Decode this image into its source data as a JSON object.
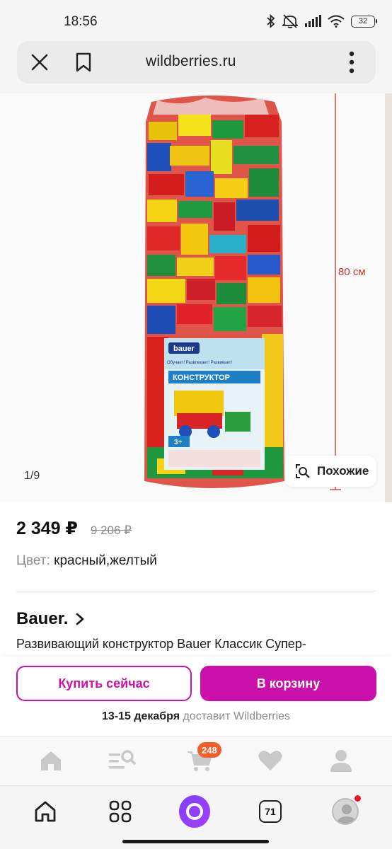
{
  "status_bar": {
    "time": "18:56",
    "battery": "32",
    "icons": [
      "bluetooth-icon",
      "mute-icon",
      "signal-icon",
      "wifi-icon",
      "battery-icon"
    ]
  },
  "browser": {
    "url": "wildberries.ru"
  },
  "gallery": {
    "counter": "1/9",
    "similar_label": "Похожие",
    "dimension_label": "80 см",
    "package_brand": "bauer",
    "package_title": "КОНСТРУКТОР",
    "package_slogan": "Обучает! Развлекает! Развивает!",
    "package_age": "3+"
  },
  "product": {
    "price_current": "2 349 ₽",
    "price_old": "9 206 ₽",
    "color_key": "Цвет:",
    "color_value": "красный,желтый",
    "brand": "Bauer.",
    "title": "Развивающий конструктор Bauer Классик Супер-"
  },
  "actions": {
    "buy_now": "Купить сейчас",
    "to_cart": "В корзину",
    "delivery_date": "13-15 декабря",
    "delivery_by": "доставит Wildberries"
  },
  "wb_nav": {
    "cart_count": "248",
    "items": [
      "home-icon",
      "catalog-search-icon",
      "cart-icon",
      "favorites-icon",
      "profile-icon"
    ]
  },
  "browser_nav": {
    "tab_count": "71"
  },
  "colors": {
    "accent": "#cb11ab",
    "badge": "#f25d2c",
    "alice": "#8a3cff"
  }
}
